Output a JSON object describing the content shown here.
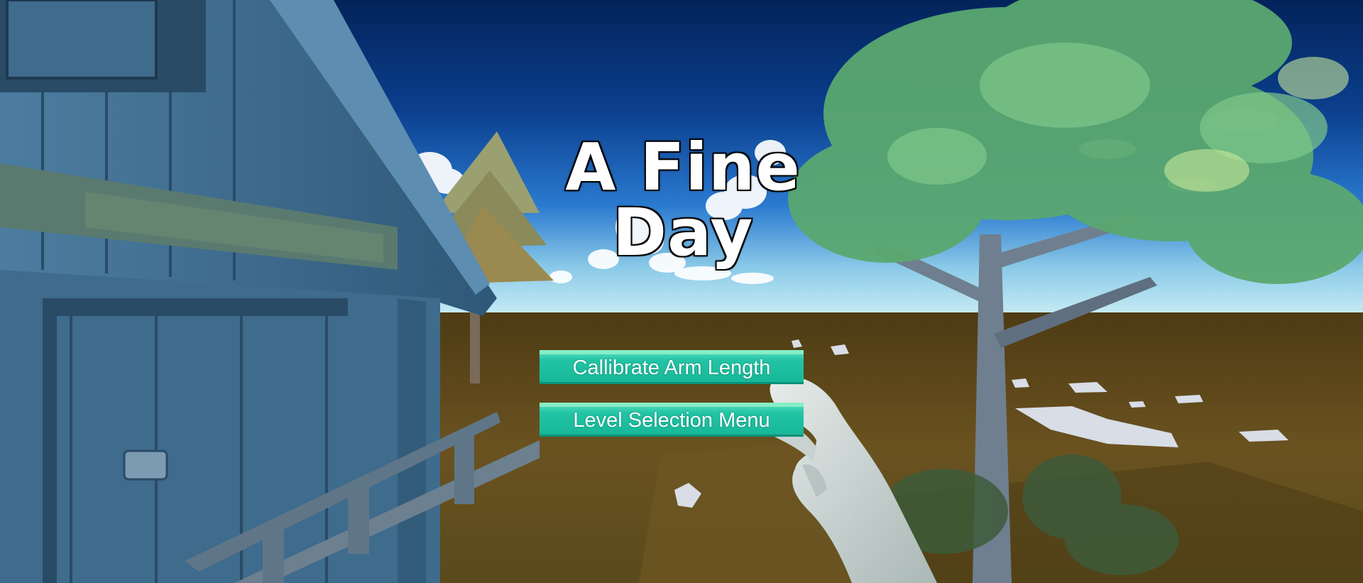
{
  "game": {
    "title": "A Fine Day"
  },
  "menu": {
    "calibrate_label": "Callibrate Arm Length",
    "level_select_label": "Level Selection Menu"
  },
  "colors": {
    "sky_top": "#03235a",
    "sky_mid": "#1e63c6",
    "sky_horizon": "#b7e4f2",
    "ground": "#5a4418",
    "button": "#1cc0a0",
    "foliage": "#5aa870",
    "house": "#3c6c8c"
  }
}
